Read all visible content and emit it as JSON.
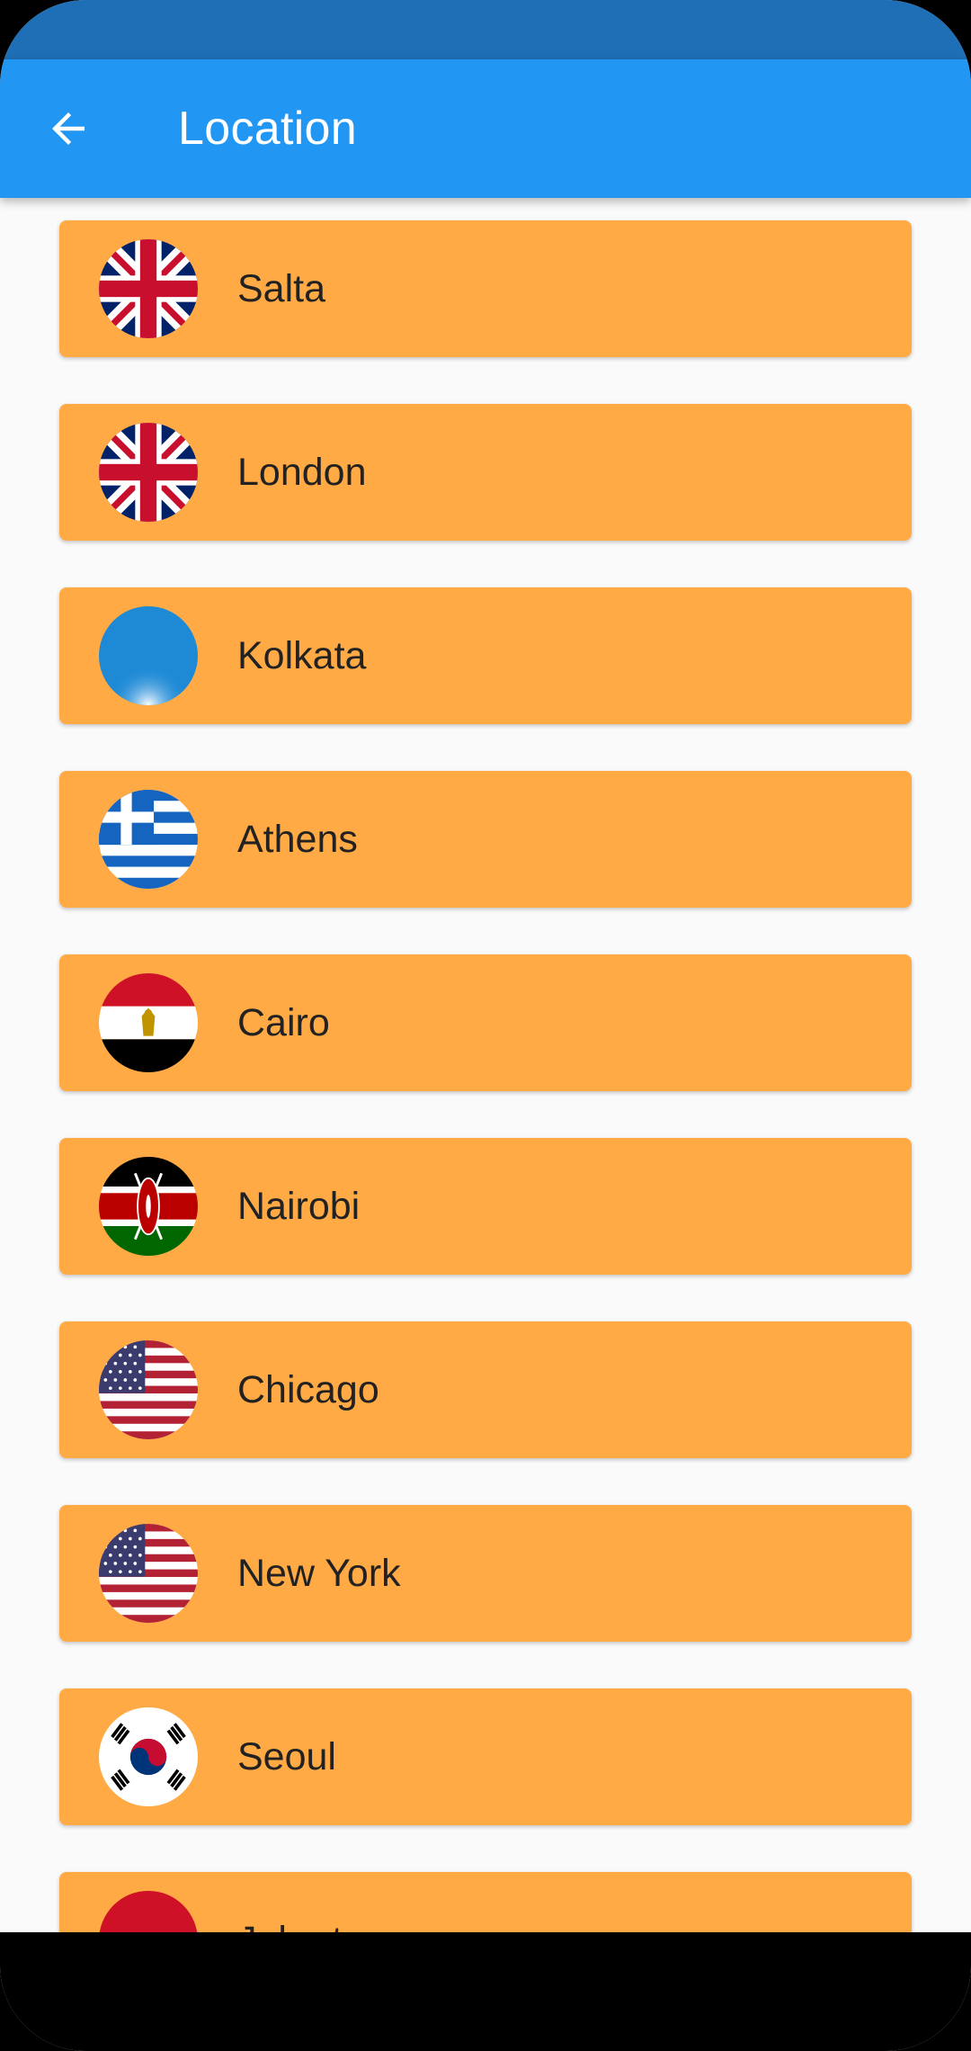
{
  "app_bar": {
    "title": "Location",
    "back_icon": "arrow-left-icon"
  },
  "colors": {
    "status_bar": "#1e6fb5",
    "app_bar": "#2196f3",
    "card": "#ffaa44",
    "background": "#fafafa"
  },
  "locations": [
    {
      "label": "Salta",
      "flag": "uk-flag-icon"
    },
    {
      "label": "London",
      "flag": "uk-flag-icon"
    },
    {
      "label": "Kolkata",
      "flag": "blue-flag-icon"
    },
    {
      "label": "Athens",
      "flag": "greece-flag-icon"
    },
    {
      "label": "Cairo",
      "flag": "egypt-flag-icon"
    },
    {
      "label": "Nairobi",
      "flag": "kenya-flag-icon"
    },
    {
      "label": "Chicago",
      "flag": "usa-flag-icon"
    },
    {
      "label": "New York",
      "flag": "usa-flag-icon"
    },
    {
      "label": "Seoul",
      "flag": "south-korea-flag-icon"
    },
    {
      "label": "Jakarta",
      "flag": "indonesia-flag-icon"
    }
  ]
}
